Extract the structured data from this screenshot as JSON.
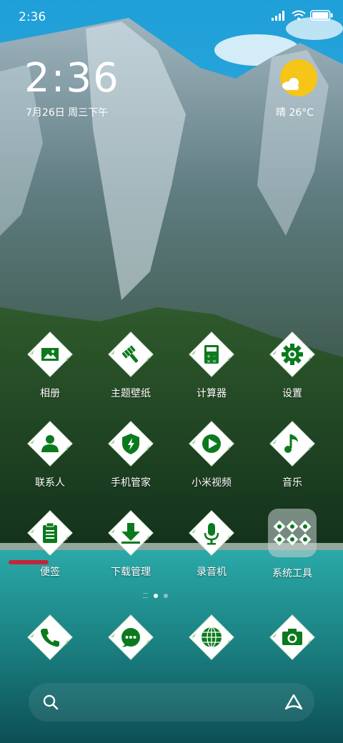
{
  "status_bar": {
    "time": "2:36"
  },
  "clock": {
    "time": "2:36",
    "date": "7月26日 周三下午"
  },
  "weather": {
    "text": "晴 26°C",
    "icon": "sun-cloud-icon"
  },
  "apps": [
    {
      "label": "相册",
      "icon": "gallery-icon"
    },
    {
      "label": "主题壁纸",
      "icon": "brush-icon"
    },
    {
      "label": "计算器",
      "icon": "calculator-icon"
    },
    {
      "label": "设置",
      "icon": "gear-icon"
    },
    {
      "label": "联系人",
      "icon": "person-icon"
    },
    {
      "label": "手机管家",
      "icon": "shield-icon"
    },
    {
      "label": "小米视频",
      "icon": "play-icon"
    },
    {
      "label": "音乐",
      "icon": "music-note-icon"
    },
    {
      "label": "便签",
      "icon": "clipboard-icon"
    },
    {
      "label": "下载管理",
      "icon": "download-icon"
    },
    {
      "label": "录音机",
      "icon": "microphone-icon"
    },
    {
      "label": "系统工具",
      "icon": "folder-icon"
    }
  ],
  "dock": [
    {
      "name": "phone",
      "icon": "phone-icon"
    },
    {
      "name": "messages",
      "icon": "chat-icon"
    },
    {
      "name": "browser",
      "icon": "globe-icon"
    },
    {
      "name": "camera",
      "icon": "camera-icon"
    }
  ],
  "search": {
    "icon": "search-icon",
    "assistant_icon": "assistant-icon"
  },
  "colors": {
    "icon_green": "#0b7a1e",
    "icon_bg": "#ffffff",
    "sun": "#f5c518"
  }
}
